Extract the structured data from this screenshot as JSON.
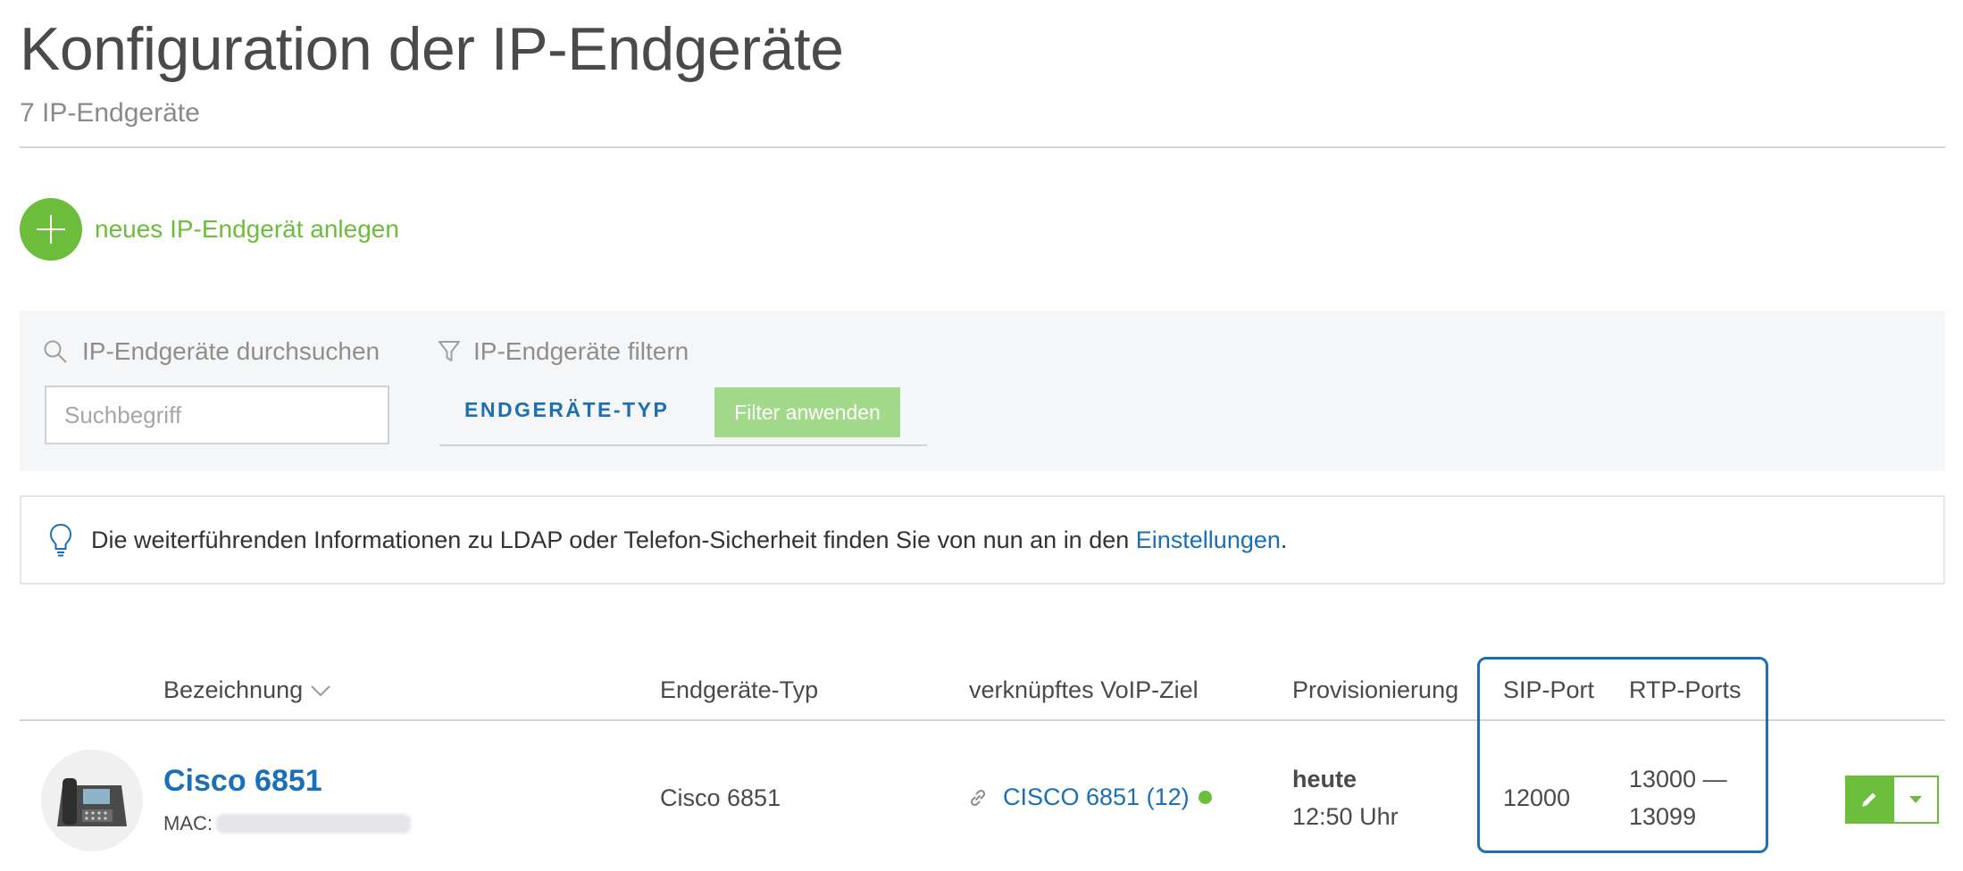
{
  "page": {
    "title": "Konfiguration der IP-Endgeräte",
    "subtitle": "7 IP-Endgeräte"
  },
  "actions": {
    "add_label": "neues IP-Endgerät anlegen"
  },
  "search": {
    "title": "IP-Endgeräte durchsuchen",
    "placeholder": "Suchbegriff",
    "value": ""
  },
  "filter": {
    "title": "IP-Endgeräte filtern",
    "type_label": "ENDGERÄTE-TYP",
    "apply_label": "Filter anwenden"
  },
  "info": {
    "text": "Die weiterführenden Informationen zu LDAP oder Telefon-Sicherheit finden Sie von nun an in den ",
    "link": "Einstellungen",
    "suffix": "."
  },
  "table": {
    "columns": {
      "name": "Bezeichnung",
      "type": "Endgeräte-Typ",
      "voip": "verknüpftes VoIP-Ziel",
      "provisioning": "Provisionierung",
      "sip": "SIP-Port",
      "rtp": "RTP-Ports"
    },
    "rows": [
      {
        "name": "Cisco 6851",
        "mac_label": "MAC:",
        "type": "Cisco 6851",
        "voip_target": "CISCO 6851 (12)",
        "provisioning_day": "heute",
        "provisioning_time": "12:50 Uhr",
        "sip_port": "12000",
        "rtp_ports_from": "13000 —",
        "rtp_ports_to": "13099"
      }
    ]
  },
  "icons": {
    "search": "search-icon",
    "filter": "filter-icon",
    "info": "lightbulb-icon",
    "sort": "chevron-down-icon",
    "link": "link-icon",
    "edit": "pencil-icon",
    "dropdown": "caret-down-icon",
    "device": "desk-phone-icon"
  },
  "colors": {
    "accent_green": "#6cbd3c",
    "link_blue": "#1a6fb5",
    "highlight_border": "#1a6fb5",
    "panel_bg": "#f5f6f7"
  }
}
